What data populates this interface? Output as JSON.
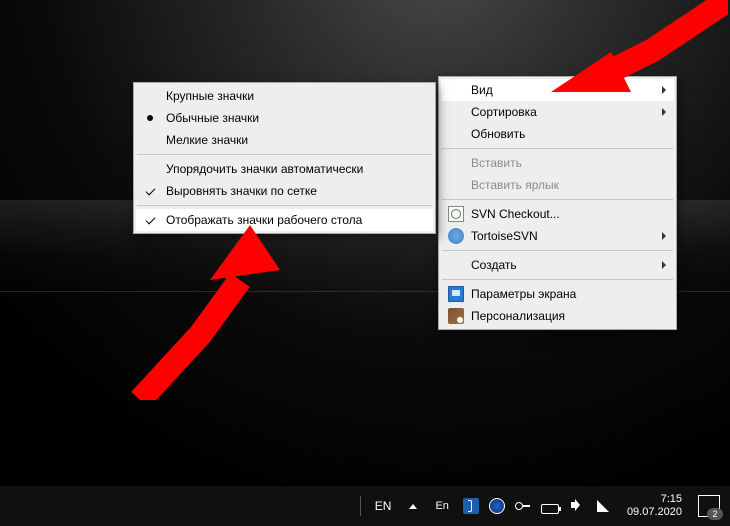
{
  "submenu": {
    "large_icons": "Крупные значки",
    "medium_icons": "Обычные значки",
    "small_icons": "Мелкие значки",
    "auto_arrange": "Упорядочить значки автоматически",
    "align_grid": "Выровнять значки по сетке",
    "show_icons": "Отображать значки рабочего стола"
  },
  "menu": {
    "view": "Вид",
    "sort": "Сортировка",
    "refresh": "Обновить",
    "paste": "Вставить",
    "paste_shortcut": "Вставить ярлык",
    "svn_checkout": "SVN Checkout...",
    "tortoise": "TortoiseSVN",
    "create": "Создать",
    "display": "Параметры экрана",
    "personalize": "Персонализация"
  },
  "taskbar": {
    "lang1": "EN",
    "lang2": "En",
    "time": "7:15",
    "date": "09.07.2020",
    "notif_count": "2"
  }
}
